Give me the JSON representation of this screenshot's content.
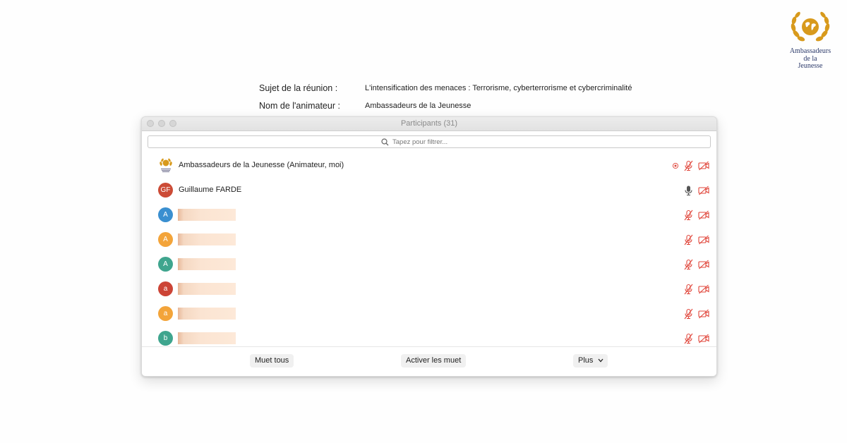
{
  "logo": {
    "line1": "Ambassadeurs",
    "line2": "de la",
    "line3": "Jeunesse"
  },
  "meeting": {
    "topic_label": "Sujet de la réunion :",
    "topic_value": "L'intensification des menaces : Terrorisme, cyberterrorisme et cybercriminalité",
    "host_label": "Nom de l'animateur :",
    "host_value": "Ambassadeurs de la Jeunesse"
  },
  "window": {
    "title": "Participants (31)",
    "search_placeholder": "Tapez pour filtrer..."
  },
  "participants": [
    {
      "initials": "",
      "avatar": "logo",
      "name": "Ambassadeurs de la Jeunesse (Animateur, moi)",
      "color": "",
      "redacted": false,
      "mic": "muted",
      "video": "off",
      "recording": true
    },
    {
      "initials": "GF",
      "avatar": "initials",
      "name": "Guillaume FARDE",
      "color": "#cc4b36",
      "redacted": false,
      "mic": "on",
      "video": "off",
      "recording": false
    },
    {
      "initials": "A",
      "avatar": "initials",
      "name": "",
      "color": "#3a8fd0",
      "redacted": true,
      "mic": "muted",
      "video": "off",
      "recording": false
    },
    {
      "initials": "A",
      "avatar": "initials",
      "name": "",
      "color": "#f3a43a",
      "redacted": true,
      "mic": "muted",
      "video": "off",
      "recording": false
    },
    {
      "initials": "A",
      "avatar": "initials",
      "name": "",
      "color": "#3fa58e",
      "redacted": true,
      "mic": "muted",
      "video": "off",
      "recording": false
    },
    {
      "initials": "a",
      "avatar": "initials",
      "name": "",
      "color": "#cc4436",
      "redacted": true,
      "mic": "muted",
      "video": "off",
      "recording": false
    },
    {
      "initials": "a",
      "avatar": "initials",
      "name": "",
      "color": "#f3a43a",
      "redacted": true,
      "mic": "muted",
      "video": "off",
      "recording": false
    },
    {
      "initials": "b",
      "avatar": "initials",
      "name": "",
      "color": "#3fa58e",
      "redacted": true,
      "mic": "muted",
      "video": "off",
      "recording": false
    }
  ],
  "footer": {
    "mute_all": "Muet tous",
    "unmute_all": "Activer les muet",
    "more": "Plus"
  },
  "colors": {
    "muted_icon": "#e0453a",
    "logo_gold": "#d89a1c"
  }
}
